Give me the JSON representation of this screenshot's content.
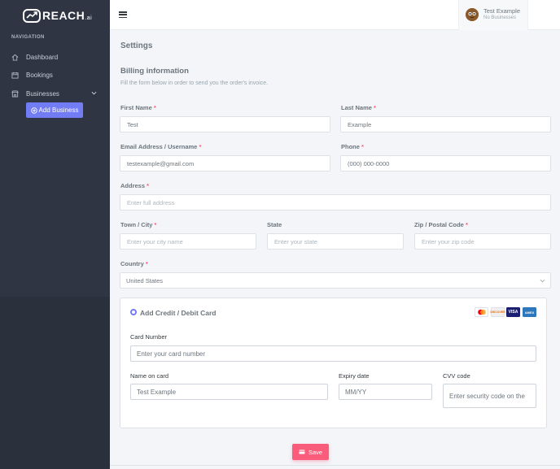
{
  "brand": {
    "name": "REACH",
    "suffix": ".ai"
  },
  "sidebar": {
    "heading": "NAVIGATION",
    "items": [
      {
        "label": "Dashboard",
        "icon": "home-icon"
      },
      {
        "label": "Bookings",
        "icon": "calendar-icon"
      },
      {
        "label": "Businesses",
        "icon": "store-icon"
      }
    ],
    "add_business_label": "Add Business"
  },
  "topbar": {
    "user": {
      "name": "Test Example",
      "subtitle": "No Businesses"
    }
  },
  "page": {
    "title": "Settings",
    "section_title": "Billing information",
    "section_subtitle": "Fill the form below in order to send you the order's invoice."
  },
  "form": {
    "first_name": {
      "label": "First Name",
      "value": "Test"
    },
    "last_name": {
      "label": "Last Name",
      "value": "Example"
    },
    "email": {
      "label": "Email Address / Username",
      "value": "testexample@gmail.com"
    },
    "phone": {
      "label": "Phone",
      "value": "(000) 000-0000"
    },
    "address": {
      "label": "Address",
      "placeholder": "Enter full address"
    },
    "town": {
      "label": "Town / City",
      "placeholder": "Enter your city name"
    },
    "state": {
      "label": "State",
      "placeholder": "Enter your state"
    },
    "zip": {
      "label": "Zip / Postal Code",
      "placeholder": "Enter your zip code"
    },
    "country": {
      "label": "Country",
      "value": "United States"
    },
    "required_mark": "*"
  },
  "card": {
    "title": "Add Credit / Debit Card",
    "logos": [
      "MC",
      "DISCOVER",
      "VISA",
      "AMEX"
    ],
    "number": {
      "label": "Card Number",
      "placeholder": "Enter your card number"
    },
    "name": {
      "label": "Name on card",
      "value": "Test Example"
    },
    "expiry": {
      "label": "Expiry date",
      "placeholder": "MM/YY"
    },
    "cvv": {
      "label": "CVV code",
      "placeholder": "Enter security code on the"
    }
  },
  "save_label": "Save",
  "colors": {
    "primary": "#727cf5",
    "danger": "#fa5c7c",
    "sidebar": "#2f3542"
  }
}
